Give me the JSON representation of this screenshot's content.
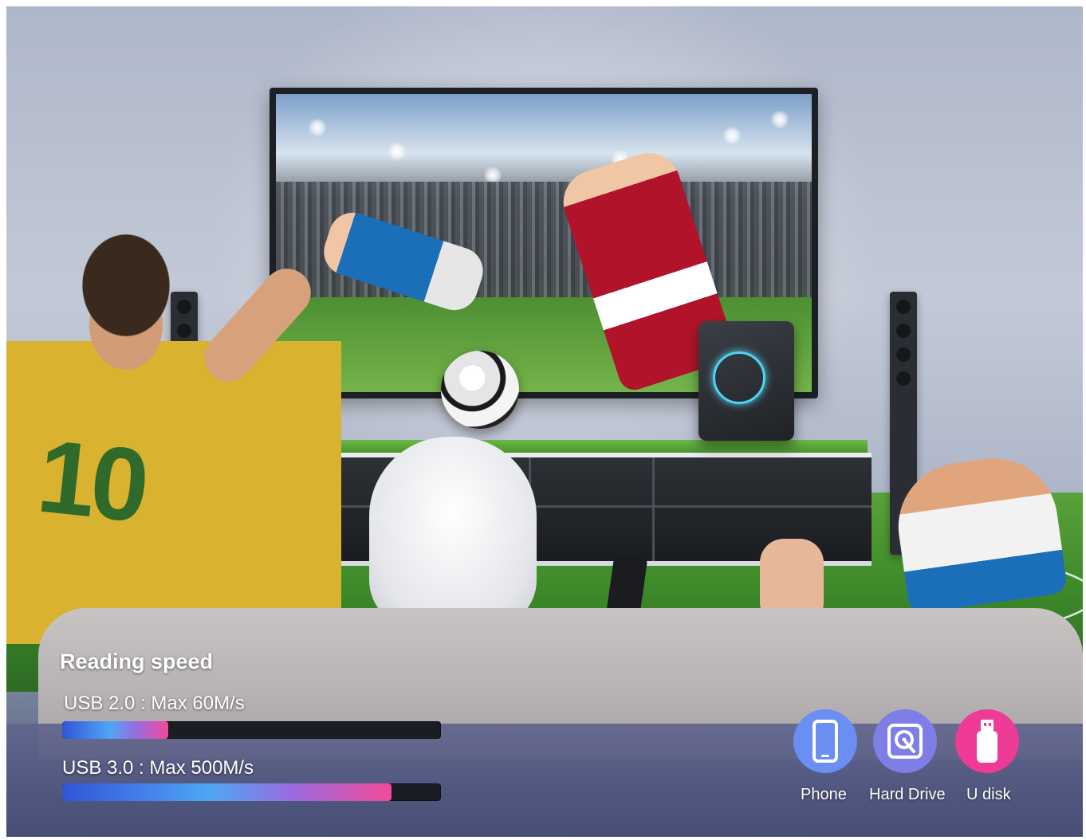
{
  "reading_speed": {
    "title": "Reading speed",
    "bars": [
      {
        "label": "USB 2.0 : Max 60M/s",
        "fill_fraction": 0.28
      },
      {
        "label": "USB 3.0 : Max 500M/s",
        "fill_fraction": 0.87
      }
    ]
  },
  "devices": [
    {
      "label": "Phone",
      "icon": "phone-icon",
      "color": "#6a8ef2"
    },
    {
      "label": "Hard Drive",
      "icon": "hard-drive-icon",
      "color": "#7d7fe6"
    },
    {
      "label": "U disk",
      "icon": "usb-disk-icon",
      "color": "#ee3b95"
    }
  ],
  "scene": {
    "jersey_number": "10"
  }
}
